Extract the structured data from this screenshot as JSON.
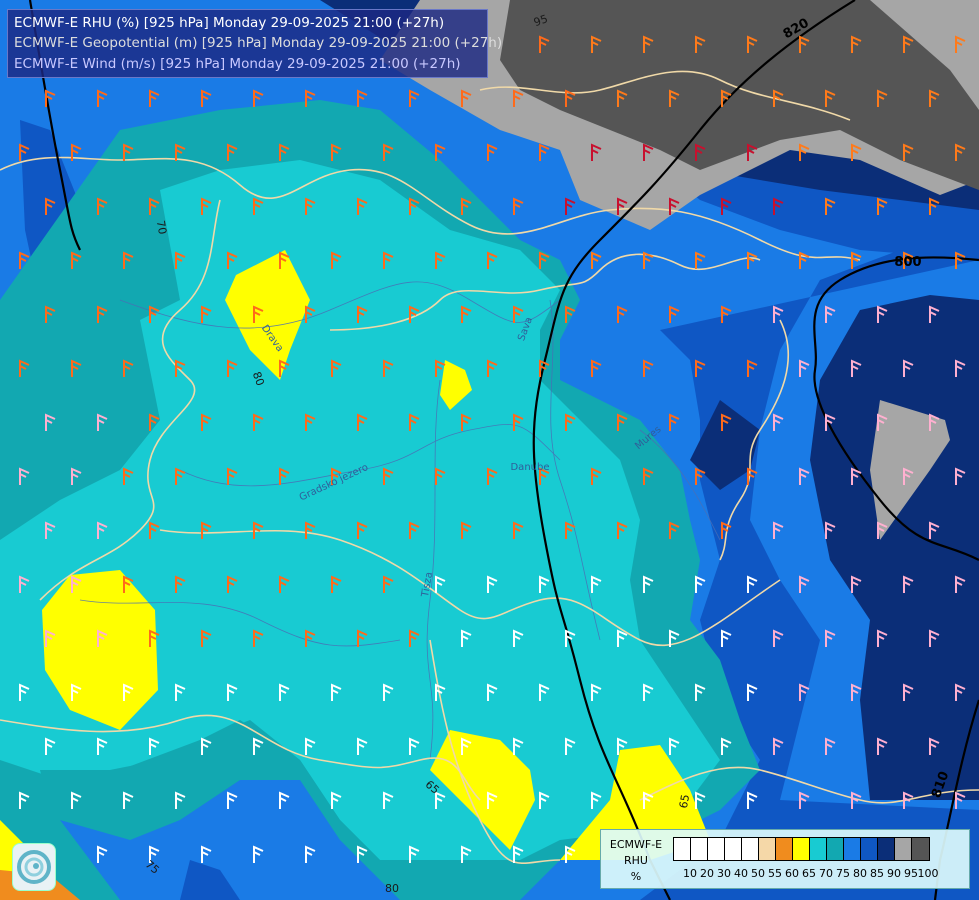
{
  "titles": {
    "line1": "ECMWF-E RHU (%) [925 hPa] Monday 29-09-2025 21:00 (+27h)",
    "line2": "ECMWF-E Geopotential (m) [925 hPa] Monday 29-09-2025 21:00 (+27h)",
    "line3": "ECMWF-E Wind (m/s) [925 hPa] Monday 29-09-2025 21:00 (+27h)",
    "colors": [
      "#ffffff",
      "#dddddd",
      "#c8c8ff"
    ]
  },
  "legend": {
    "model": "ECMWF-E",
    "variable": "RHU",
    "unit": "%",
    "ticks": [
      "10",
      "20",
      "30",
      "40",
      "50",
      "55",
      "60",
      "65",
      "70",
      "75",
      "80",
      "85",
      "90",
      "95",
      "100"
    ],
    "colors": [
      "#ffffff",
      "#ffffff",
      "#ffffff",
      "#ffffff",
      "#ffffff",
      "#f5d8a8",
      "#f08c1e",
      "#ffff00",
      "#18cbd2",
      "#12a8b1",
      "#1a7be6",
      "#0f57c4",
      "#0b2e78",
      "#a6a6a6",
      "#555555"
    ]
  },
  "map": {
    "contour_labels": {
      "geopotential": [
        "820",
        "800",
        "810"
      ],
      "rhu": [
        "95",
        "70",
        "65",
        "75",
        "80",
        "65",
        "80"
      ]
    },
    "place_labels": [
      "Gradsko jezero",
      "Sava",
      "Drava",
      "Danube",
      "Tisza",
      "Mures"
    ],
    "colors": {
      "rhu_60": "#f08c1e",
      "rhu_65": "#ffff00",
      "rhu_70": "#18cbd2",
      "rhu_75": "#12a8b1",
      "rhu_80": "#1a7be6",
      "rhu_85": "#0f57c4",
      "rhu_90": "#0b2e78",
      "rhu_95": "#a6a6a6",
      "rhu_100": "#555555",
      "border": "#f0d9a8",
      "river": "#4a6fb5",
      "geopotential_contour": "#000000"
    }
  },
  "icons": {
    "logo": "ecmwf-swirl-logo-icon",
    "wind": "wind-barb-icon"
  }
}
